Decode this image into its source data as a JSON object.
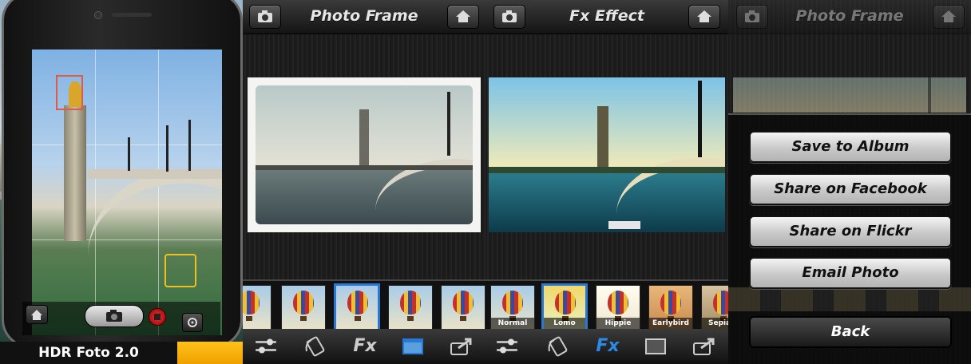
{
  "hdr_panel": {
    "caption": "HDR Foto 2.0",
    "icons": [
      "home-icon",
      "camera-icon",
      "record-icon",
      "settings-icon"
    ]
  },
  "frame_panel": {
    "title": "Photo Frame",
    "left_button_icon": "camera-icon",
    "right_button_icon": "home-icon",
    "thumbnails": 5,
    "bottom_icons": [
      "sliders-icon",
      "rotate-icon",
      "fx-icon",
      "frame-icon",
      "share-icon"
    ]
  },
  "fx_panel": {
    "title": "Fx Effect",
    "left_button_icon": "camera-icon",
    "right_button_icon": "home-icon",
    "filters": [
      "Normal",
      "Lomo",
      "Hippie",
      "Earlybird",
      "Sepia C"
    ],
    "selected_filter": "Lomo",
    "bottom_icons": [
      "sliders-icon",
      "rotate-icon",
      "fx-icon",
      "frame-icon",
      "share-icon"
    ],
    "accent": "#2a78d6"
  },
  "share_panel": {
    "title": "Photo Frame",
    "buttons": [
      "Save to Album",
      "Share on Facebook",
      "Share on Flickr",
      "Email Photo"
    ],
    "back_label": "Back"
  }
}
